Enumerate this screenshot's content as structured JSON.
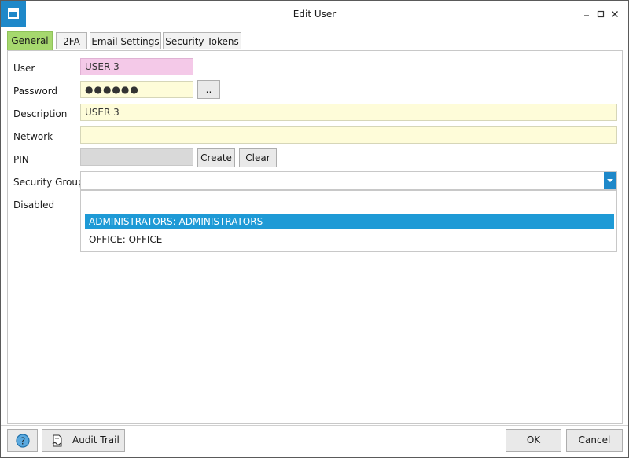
{
  "window": {
    "title": "Edit User"
  },
  "tabs": [
    {
      "label": "General"
    },
    {
      "label": "2FA"
    },
    {
      "label": "Email Settings"
    },
    {
      "label": "Security Tokens"
    }
  ],
  "form": {
    "user_label": "User",
    "user_value": "USER 3",
    "password_label": "Password",
    "password_value": "●●●●●●",
    "password_button": "..",
    "description_label": "Description",
    "description_value": "USER 3",
    "network_label": "Network",
    "network_value": "",
    "pin_label": "PIN",
    "pin_value": "",
    "pin_create": "Create",
    "pin_clear": "Clear",
    "security_group_label": "Security Group",
    "security_group_value": "",
    "security_group_options": [
      "ADMINISTRATORS: ADMINISTRATORS",
      "OFFICE: OFFICE"
    ],
    "disabled_label": "Disabled"
  },
  "footer": {
    "audit_trail": "Audit Trail",
    "ok": "OK",
    "cancel": "Cancel"
  },
  "colors": {
    "accent": "#1e88c9",
    "active_tab": "#a6d86e",
    "required_field": "#f4c9e8",
    "editable_field": "#fefcd9",
    "selected_option": "#1e9ad6"
  },
  "icons": {
    "app": "window-icon",
    "minimize": "minimize-icon",
    "maximize": "maximize-icon",
    "close": "close-icon",
    "help": "help-icon",
    "audit": "audit-trail-icon",
    "dropdown": "chevron-down-icon"
  }
}
